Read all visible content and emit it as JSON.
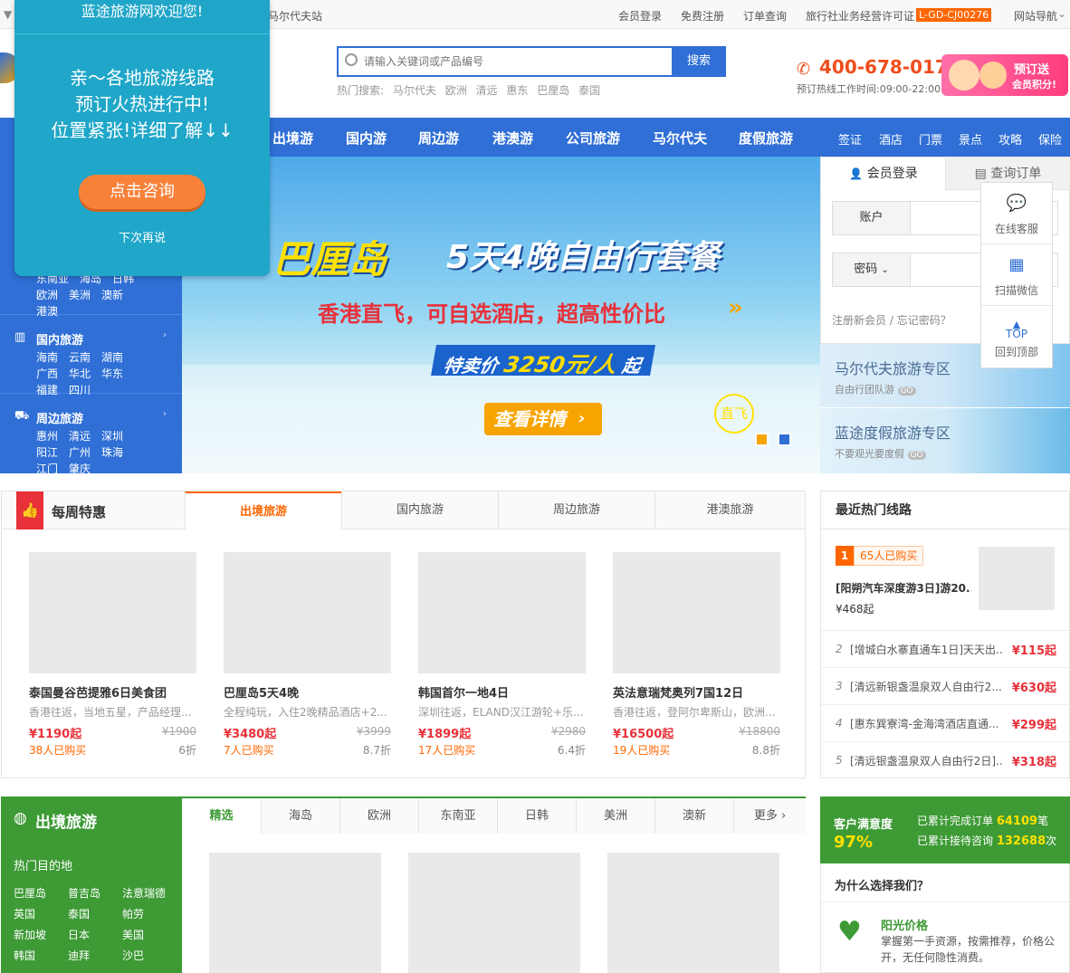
{
  "topbar": {
    "site_station": "马尔代夫站",
    "links": [
      "会员登录",
      "免费注册",
      "订单查询"
    ],
    "license_text": "旅行社业务经营许可证",
    "license_no": "L-GD-CJ00276",
    "site_nav": "网站导航"
  },
  "header": {
    "search_placeholder": "请输入关键词或产品编号",
    "search_button": "搜索",
    "hot_label": "热门搜索:",
    "hot_words": [
      "马尔代夫",
      "欧洲",
      "清远",
      "惠东",
      "巴厘岛",
      "泰国"
    ],
    "phone": "400-678-0175",
    "phone_hours": "预订热线工作时间:09:00-22:00",
    "promo_text_1": "预订送",
    "promo_text_2": "会员积分!"
  },
  "nav": {
    "main": [
      "出境游",
      "国内游",
      "周边游",
      "港澳游",
      "公司旅游",
      "马尔代夫",
      "度假旅游"
    ],
    "small": [
      "签证",
      "酒店",
      "门票",
      "景点",
      "攻略",
      "保险"
    ]
  },
  "left_categories": [
    {
      "title": "",
      "links": [
        "东南亚",
        "海岛",
        "日韩",
        "欧洲",
        "美洲",
        "澳新",
        "港澳"
      ]
    },
    {
      "title": "国内旅游",
      "links": [
        "海南",
        "云南",
        "湖南",
        "广西",
        "华北",
        "华东",
        "福建",
        "四川"
      ]
    },
    {
      "title": "周边旅游",
      "links": [
        "惠州",
        "清远",
        "深圳",
        "阳江",
        "广州",
        "珠海",
        "江门",
        "肇庆"
      ]
    }
  ],
  "banner": {
    "title": "巴厘岛",
    "subtitle": "5天4晚自由行套餐",
    "tagline": "香港直飞，可自选酒店，超高性价比",
    "price_label": "特卖价",
    "price": "3250元/人",
    "price_suffix": "起",
    "detail_button": "查看详情",
    "badge": "直飞"
  },
  "login": {
    "tab_login": "会员登录",
    "tab_order": "查询订单",
    "account_label": "账户",
    "password_label": "密码",
    "register": "注册新会员",
    "forgot": "忘记密码？"
  },
  "zones": [
    {
      "title": "马尔代夫旅游专区",
      "sub": "自由行团队游"
    },
    {
      "title": "蓝途度假旅游专区",
      "sub": "不要观光要度假"
    }
  ],
  "floatbar": {
    "items": [
      "在线客服",
      "扫描微信",
      "回到顶部"
    ],
    "top_label": "TOP"
  },
  "popup": {
    "welcome": "蓝途旅游网欢迎您!",
    "line1": "亲～各地旅游线路",
    "line2": "预订火热进行中!",
    "line3": "位置紧张!详细了解↓↓",
    "button": "点击咨询",
    "later": "下次再说"
  },
  "weekly": {
    "title": "每周特惠",
    "tabs": [
      "出境旅游",
      "国内旅游",
      "周边旅游",
      "港澳旅游"
    ],
    "cards": [
      {
        "name": "泰国曼谷芭提雅6日美食团",
        "desc": "香港往返，当地五星，产品经理...",
        "price": "¥1190起",
        "orig": "¥1900",
        "bought": "38人已购买",
        "discount": "6折"
      },
      {
        "name": "巴厘岛5天4晚",
        "desc": "全程纯玩，入住2晚精品酒店+2...",
        "price": "¥3480起",
        "orig": "¥3999",
        "bought": "7人已购买",
        "discount": "8.7折"
      },
      {
        "name": "韩国首尔一地4日",
        "desc": "深圳往返，ELAND汉江游轮+乐...",
        "price": "¥1899起",
        "orig": "¥2980",
        "bought": "17人已购买",
        "discount": "6.4折"
      },
      {
        "name": "英法意瑞梵奥列7国12日",
        "desc": "香港往返，登阿尔卑斯山，欧洲...",
        "price": "¥16500起",
        "orig": "¥18800",
        "bought": "19人已购买",
        "discount": "8.8折"
      }
    ]
  },
  "hot_routes": {
    "title": "最近热门线路",
    "top": {
      "rank": "1",
      "bought": "65人已购买",
      "name": "[阳朔汽车深度游3日]游20...",
      "price": "¥468起"
    },
    "list": [
      {
        "rank": "2",
        "name": "[增城白水寨直通车1日]天天出...",
        "price": "¥115起"
      },
      {
        "rank": "3",
        "name": "[清远新银盏温泉双人自由行2...",
        "price": "¥630起"
      },
      {
        "rank": "4",
        "name": "[惠东巽寮湾-金海湾酒店直通...",
        "price": "¥299起"
      },
      {
        "rank": "5",
        "name": "[清远银盏温泉双人自由行2日]...",
        "price": "¥318起"
      }
    ]
  },
  "outbound": {
    "title": "出境旅游",
    "hot_label": "热门目的地",
    "destinations": [
      "巴厘岛",
      "普吉岛",
      "法意瑞德",
      "英国",
      "泰国",
      "帕劳",
      "新加坡",
      "日本",
      "美国",
      "韩国",
      "迪拜",
      "沙巴"
    ],
    "tabs": [
      "精选",
      "海岛",
      "欧洲",
      "东南亚",
      "日韩",
      "美洲",
      "澳新",
      "更多"
    ]
  },
  "satisfaction": {
    "label": "客户满意度",
    "value": "97%",
    "orders_label": "已累计完成订单",
    "orders": "64109",
    "orders_unit": "笔",
    "consult_label": "已累计接待咨询",
    "consult": "132688",
    "consult_unit": "次"
  },
  "why": {
    "title": "为什么选择我们？",
    "item_title": "阳光价格",
    "item_desc": "掌握第一手资源，按需推荐，价格公开，无任何隐性消费。"
  }
}
